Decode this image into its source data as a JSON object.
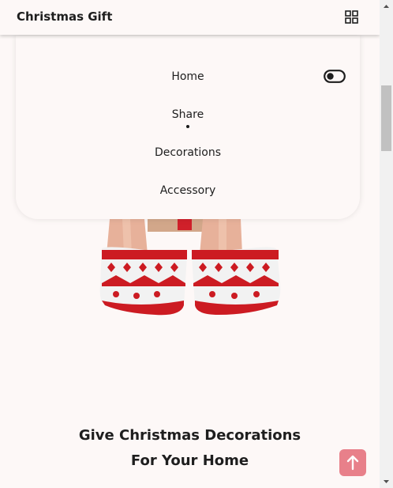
{
  "header": {
    "logo": "Christmas Gift",
    "menu_icon": "grid-icon"
  },
  "nav": {
    "items": [
      {
        "label": "Home"
      },
      {
        "label": "Share",
        "active": true
      },
      {
        "label": "Decorations"
      },
      {
        "label": "Accessory"
      }
    ],
    "theme_toggle_icon": "toggle-icon"
  },
  "hero": {
    "image": "christmas-socks-image"
  },
  "home_section": {
    "title_line1": "Give Christmas Decorations",
    "title_line2": "For Your Home"
  },
  "scroll_up": {
    "icon": "arrow-up-icon"
  },
  "colors": {
    "background": "#fdf8f7",
    "accent": "#e8808a",
    "sock_red": "#c8141c"
  }
}
